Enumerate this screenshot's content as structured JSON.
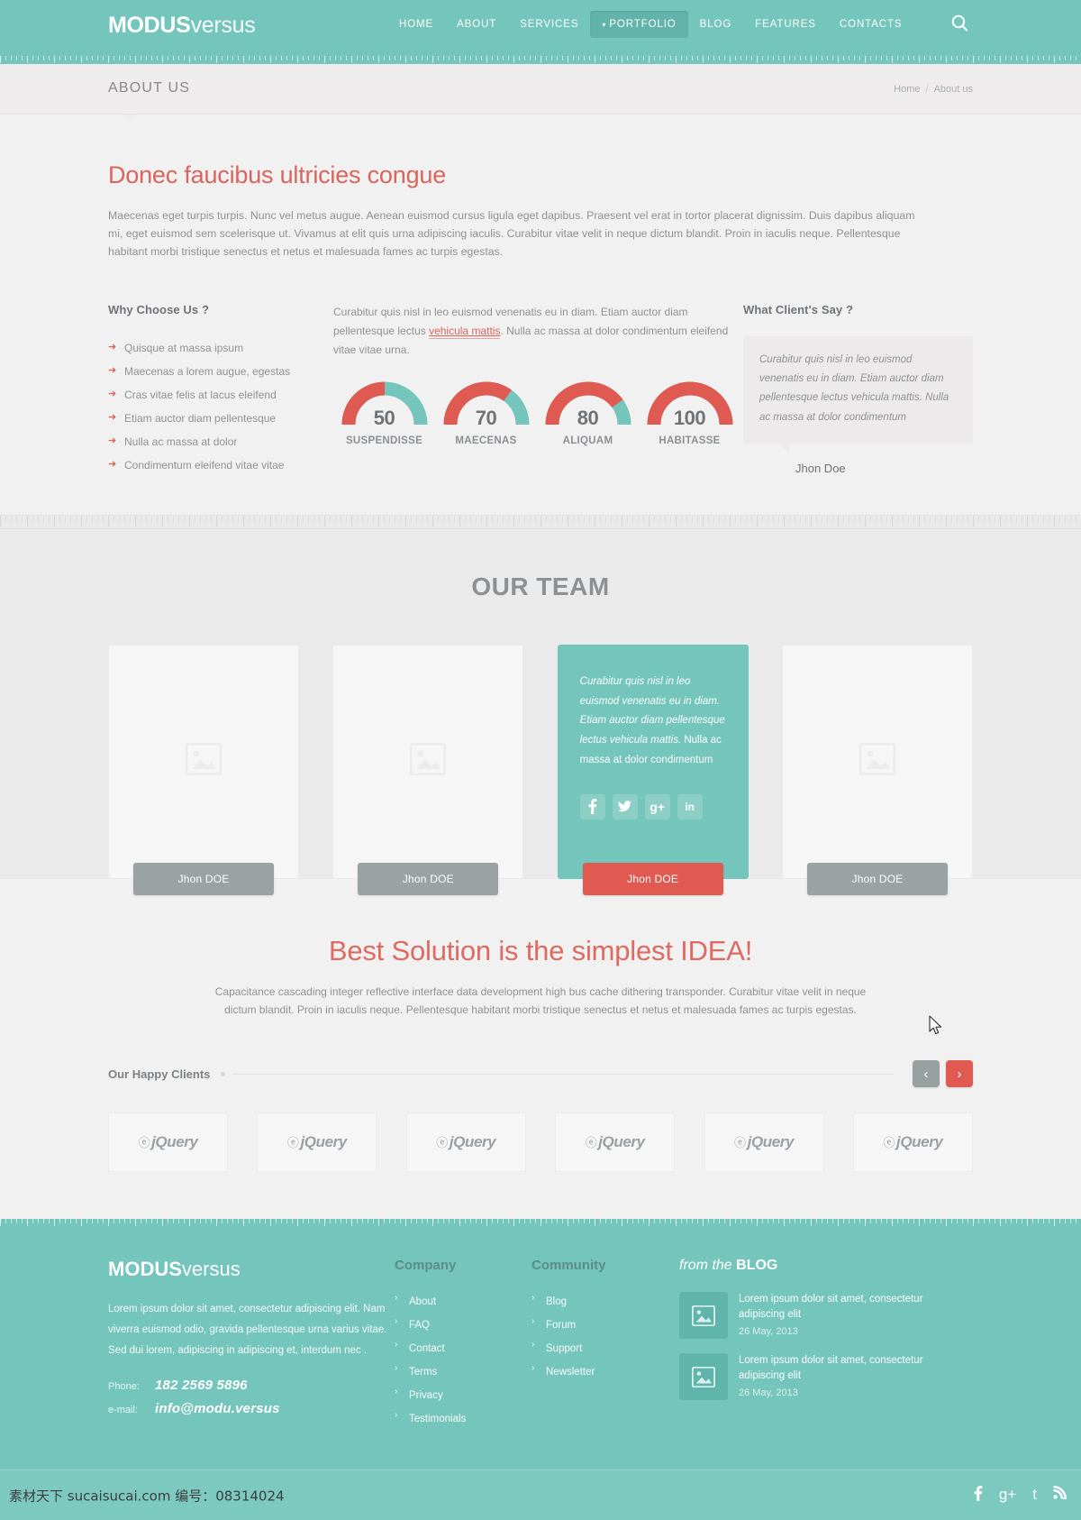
{
  "header": {
    "logo_bold": "MODUS",
    "logo_light": "versus",
    "nav": [
      {
        "label": "HOME",
        "active": false
      },
      {
        "label": "ABOUT",
        "active": false
      },
      {
        "label": "SERVICES",
        "active": false
      },
      {
        "label": "PORTFOLIO",
        "active": true
      },
      {
        "label": "BLOG",
        "active": false
      },
      {
        "label": "FEATURES",
        "active": false
      },
      {
        "label": "CONTACTS",
        "active": false
      }
    ],
    "search_icon": "search-icon",
    "accent_teal": "#74c5bb",
    "accent_red": "#d9655c"
  },
  "titlebar": {
    "title": "ABOUT US",
    "breadcrumb_home": "Home",
    "breadcrumb_sep": "/",
    "breadcrumb_current": "About us"
  },
  "intro": {
    "heading": "Donec faucibus ultricies congue",
    "paragraph": "Maecenas eget turpis turpis. Nunc vel metus augue. Aenean euismod cursus ligula eget dapibus. Praesent vel erat in tortor placerat dignissim. Duis dapibus aliquam mi, eget euismod sem scelerisque ut. Vivamus at elit quis urna adipiscing iaculis. Curabitur vitae velit in neque dictum blandit. Proin in iaculis neque. Pellentesque habitant morbi tristique senectus et netus et malesuada fames ac turpis egestas."
  },
  "why": {
    "heading": "Why Choose Us ?",
    "items": [
      "Quisque at massa ipsum",
      "Maecenas a lorem augue, egestas",
      "Cras vitae felis at lacus eleifend",
      "Etiam auctor diam pellentesque",
      "Nulla ac massa at dolor",
      "Condimentum eleifend vitae vitae"
    ]
  },
  "stats": {
    "intro_part1": "Curabitur quis nisl in leo euismod venenatis eu in diam. Etiam auctor diam pellentesque lectus ",
    "intro_link": "vehicula mattis",
    "intro_part2": ". Nulla ac massa at dolor condimentum eleifend vitae vitae urna."
  },
  "chart_data": {
    "type": "gauge",
    "title": "",
    "categories": [
      "SUSPENDISSE",
      "MAECENAS",
      "ALIQUAM",
      "HABITASSE"
    ],
    "values": [
      50,
      70,
      80,
      100
    ],
    "max": 100,
    "filled_color": "#df5b52",
    "track_color": "#74c5bb",
    "value_label_color": "#6f7376",
    "ylim": [
      0,
      100
    ],
    "grid": false,
    "legend": "none"
  },
  "testimonial": {
    "heading": "What Client's Say ?",
    "quote": "Curabitur quis nisl in leo euismod venenatis eu in diam. Etiam auctor diam pellentesque lectus vehicula mattis. Nulla ac massa at dolor condimentum",
    "author": "Jhon Doe"
  },
  "team": {
    "heading": "OUR TEAM",
    "members": [
      {
        "name": "Jhon DOE",
        "active": false,
        "placeholder_icon": "image-placeholder-icon"
      },
      {
        "name": "Jhon DOE",
        "active": false,
        "placeholder_icon": "image-placeholder-icon"
      },
      {
        "name": "Jhon DOE",
        "active": true,
        "placeholder_icon": ""
      },
      {
        "name": "Jhon DOE",
        "active": false,
        "placeholder_icon": "image-placeholder-icon"
      }
    ],
    "active_quote_italic": "Curabitur quis nisl in leo euismod venenatis eu in diam. Etiam auctor diam pellentesque lectus vehicula mattis.",
    "active_quote_normal": " Nulla ac massa at dolor condimentum",
    "social": [
      {
        "name": "facebook-icon",
        "glyph": "f"
      },
      {
        "name": "twitter-icon",
        "glyph": "t"
      },
      {
        "name": "google-plus-icon",
        "glyph": "g+"
      },
      {
        "name": "linkedin-icon",
        "glyph": "in"
      }
    ]
  },
  "slogan": {
    "heading": "Best Solution is the simplest IDEA!",
    "paragraph": "Capacitance cascading integer reflective interface data development high bus cache dithering transponder. Curabitur vitae velit in neque dictum blandit. Proin in iaculis neque. Pellentesque habitant morbi tristique senectus et netus et malesuada fames ac turpis egestas."
  },
  "clients": {
    "heading": "Our Happy Clients",
    "prev_label": "‹",
    "next_label": "›",
    "logos": [
      "jQuery",
      "jQuery",
      "jQuery",
      "jQuery",
      "jQuery",
      "jQuery"
    ]
  },
  "footer": {
    "logo_bold": "MODUS",
    "logo_light": "versus",
    "about": "Lorem ipsum dolor sit amet, consectetur adipiscing elit. Nam viverra euismod odio, gravida pellentesque urna varius vitae. Sed dui lorem, adipiscing in adipiscing et, interdum nec .",
    "phone_label": "Phone:",
    "phone_value": "182 2569 5896",
    "email_label": "e-mail:",
    "email_value": "info@modu.versus",
    "company": {
      "title": "Company",
      "items": [
        "About",
        "FAQ",
        "Contact",
        "Terms",
        "Privacy",
        "Testimonials"
      ]
    },
    "community": {
      "title": "Community",
      "items": [
        "Blog",
        "Forum",
        "Support",
        "Newsletter"
      ]
    },
    "blog": {
      "title_italic": "from the ",
      "title_bold": "BLOG",
      "posts": [
        {
          "title": "Lorem ipsum dolor sit amet, consectetur adipiscing elit",
          "date": "26 May, 2013"
        },
        {
          "title": "Lorem ipsum dolor sit amet, consectetur adipiscing elit",
          "date": "26 May, 2013"
        }
      ]
    },
    "watermark": "素材天下 sucaisucai.com  编号：08314024",
    "bottom_social": [
      {
        "name": "facebook-icon",
        "glyph": "f"
      },
      {
        "name": "google-plus-icon",
        "glyph": "g+"
      },
      {
        "name": "twitter-icon",
        "glyph": "t"
      },
      {
        "name": "rss-icon",
        "glyph": "ʀ"
      }
    ]
  }
}
